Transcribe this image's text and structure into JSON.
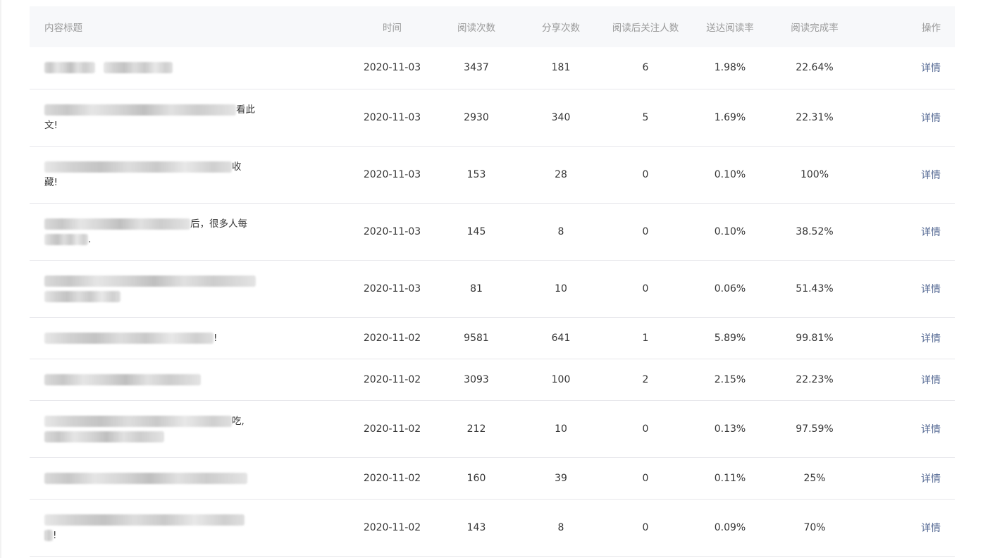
{
  "table": {
    "headers": {
      "title": "内容标题",
      "time": "时间",
      "reads": "阅读次数",
      "shares": "分享次数",
      "follows": "阅读后关注人数",
      "delivery_rate": "送达阅读率",
      "completion_rate": "阅读完成率",
      "action": "操作"
    },
    "rows": [
      {
        "title_parts": [],
        "time": "2020-11-03",
        "reads": "3437",
        "shares": "181",
        "follows": "6",
        "delivery_rate": "1.98%",
        "completion_rate": "22.64%",
        "action": "详情"
      },
      {
        "title_parts": [
          "看此",
          "文!"
        ],
        "time": "2020-11-03",
        "reads": "2930",
        "shares": "340",
        "follows": "5",
        "delivery_rate": "1.69%",
        "completion_rate": "22.31%",
        "action": "详情"
      },
      {
        "title_parts": [
          "收",
          "藏!"
        ],
        "time": "2020-11-03",
        "reads": "153",
        "shares": "28",
        "follows": "0",
        "delivery_rate": "0.10%",
        "completion_rate": "100%",
        "action": "详情"
      },
      {
        "title_parts": [
          "后，很多人每",
          "."
        ],
        "time": "2020-11-03",
        "reads": "145",
        "shares": "8",
        "follows": "0",
        "delivery_rate": "0.10%",
        "completion_rate": "38.52%",
        "action": "详情"
      },
      {
        "title_parts": [],
        "time": "2020-11-03",
        "reads": "81",
        "shares": "10",
        "follows": "0",
        "delivery_rate": "0.06%",
        "completion_rate": "51.43%",
        "action": "详情"
      },
      {
        "title_parts": [
          "!"
        ],
        "time": "2020-11-02",
        "reads": "9581",
        "shares": "641",
        "follows": "1",
        "delivery_rate": "5.89%",
        "completion_rate": "99.81%",
        "action": "详情"
      },
      {
        "title_parts": [],
        "time": "2020-11-02",
        "reads": "3093",
        "shares": "100",
        "follows": "2",
        "delivery_rate": "2.15%",
        "completion_rate": "22.23%",
        "action": "详情"
      },
      {
        "title_parts": [
          "吃,"
        ],
        "time": "2020-11-02",
        "reads": "212",
        "shares": "10",
        "follows": "0",
        "delivery_rate": "0.13%",
        "completion_rate": "97.59%",
        "action": "详情"
      },
      {
        "title_parts": [],
        "time": "2020-11-02",
        "reads": "160",
        "shares": "39",
        "follows": "0",
        "delivery_rate": "0.11%",
        "completion_rate": "25%",
        "action": "详情"
      },
      {
        "title_parts": [
          "!"
        ],
        "time": "2020-11-02",
        "reads": "143",
        "shares": "8",
        "follows": "0",
        "delivery_rate": "0.09%",
        "completion_rate": "70%",
        "action": "详情"
      }
    ]
  },
  "colors": {
    "header_bg": "#f7f8fa",
    "header_text": "#9a9a9a",
    "body_text": "#353535",
    "link": "#576b95",
    "row_border": "#e7e7eb"
  }
}
